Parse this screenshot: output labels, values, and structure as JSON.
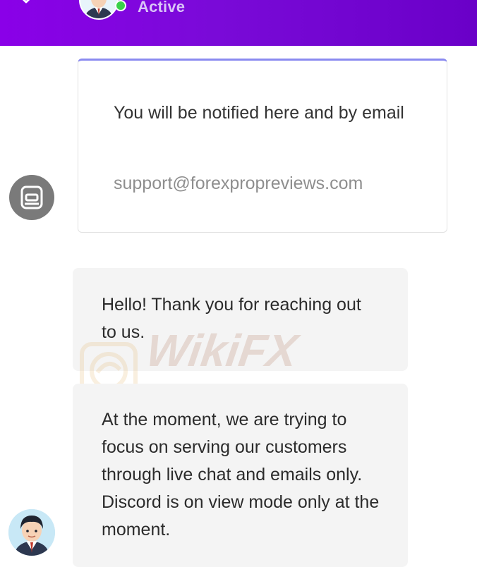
{
  "header": {
    "status_text": "Active",
    "status_color": "#3ad04a",
    "icons": {
      "back": "chevron-down-icon",
      "avatar": "agent-avatar"
    }
  },
  "notice": {
    "message": "You will be notified here and by email",
    "email": "support@forexpropreviews.com",
    "icon": "chat-bubble-icon"
  },
  "messages": [
    {
      "text": "Hello! Thank you for reaching out to us."
    },
    {
      "text": "At the moment, we are trying to focus on serving our customers through live chat and emails only. Discord is on view mode only at the moment."
    }
  ],
  "watermark": {
    "text": "WikiFX"
  },
  "colors": {
    "header_gradient_start": "#8a00e8",
    "header_gradient_end": "#6a00c8",
    "bubble_bg": "#f4f4f4",
    "card_top_border": "#8a8af0"
  }
}
